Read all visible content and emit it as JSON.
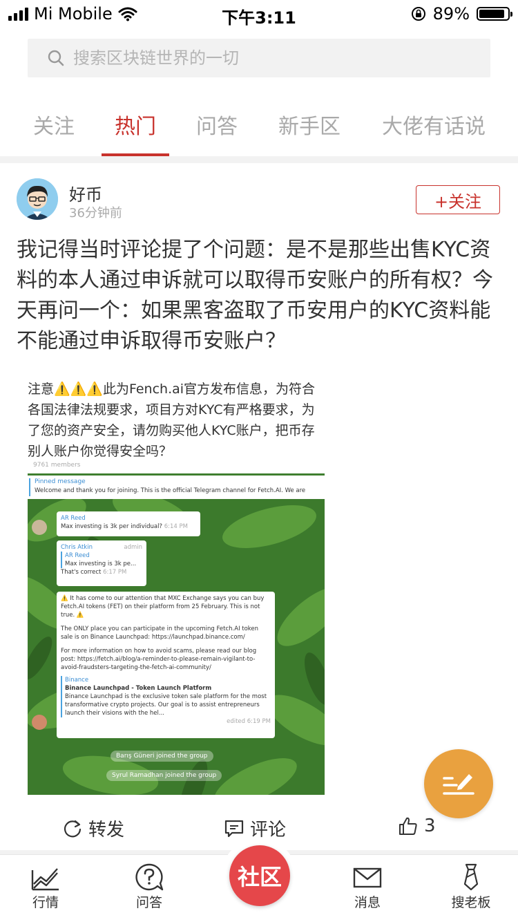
{
  "status_bar": {
    "carrier": "Mi Mobile",
    "time": "下午3:11",
    "battery": "89%",
    "battery_level": 0.89
  },
  "search": {
    "placeholder": "搜索区块链世界的一切"
  },
  "tabs": [
    {
      "label": "关注",
      "active": false
    },
    {
      "label": "热门",
      "active": true
    },
    {
      "label": "问答",
      "active": false
    },
    {
      "label": "新手区",
      "active": false
    },
    {
      "label": "大佬有话说",
      "active": false
    }
  ],
  "post": {
    "author": "好币",
    "time": "36分钟前",
    "follow_label": "+关注",
    "text": "我记得当时评论提了个问题：是不是那些出售KYC资料的本人通过申诉就可以取得币安账户的所有权？今天再问一个：如果黑客盗取了币安用户的KYC资料能不能通过申诉取得币安账户？",
    "image": {
      "notice": "注意⚠️⚠️⚠️此为Fench.ai官方发布信息，为符合各国法律法规要求，项目方对KYC有严格要求，为了您的资产安全，请勿购买他人KYC账户，把币存别人账户你觉得安全吗？",
      "members": "9761 members",
      "pinned_title": "Pinned message",
      "pinned_text": "Welcome and thank you for joining. This is the official Telegram channel for Fetch.AI. We are",
      "msg1_name": "AR Reed",
      "msg1_text": "Max investing is 3k per individual?",
      "msg1_time": "6:14 PM",
      "msg2_name": "Chris Atkin",
      "msg2_role": "admin",
      "msg2_quote_name": "AR Reed",
      "msg2_quote": "Max investing is 3k pe...",
      "msg2_text": "That's correct",
      "msg2_time": "6:17 PM",
      "msg3_p1": "⚠️ It has come to our attention that MXC Exchange says you can buy Fetch.AI tokens (FET) on their platform from 25 February. This is not true. ⚠️",
      "msg3_p2": "The ONLY place you can participate in the upcoming Fetch.AI token sale is on Binance Launchpad: https://launchpad.binance.com/",
      "msg3_p3": "For more information on how to avoid scams, please read our blog post: https://fetch.ai/blog/a-reminder-to-please-remain-vigilant-to-avoid-fraudsters-targeting-the-fetch-ai-community/",
      "msg3_link_site": "Binance",
      "msg3_link_title": "Binance Launchpad - Token Launch Platform",
      "msg3_link_desc": "Binance Launchpad is the exclusive token sale platform for the most transformative crypto projects. Our goal is to assist entrepreneurs launch their visions with the hel...",
      "msg3_time": "edited 6:19 PM",
      "join1": "Barış Güneri joined the group",
      "join2": "Syrul Ramadhan joined the group"
    }
  },
  "actions": {
    "repost": "转发",
    "comment": "评论",
    "like_count": "3"
  },
  "bottom_nav": {
    "market": "行情",
    "qa": "问答",
    "community": "社区",
    "messages": "消息",
    "search_boss": "搜老板"
  },
  "colors": {
    "accent": "#c8322c",
    "fab": "#e9a13f",
    "community_button": "#e5474a"
  }
}
